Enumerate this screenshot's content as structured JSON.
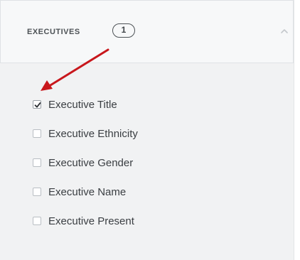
{
  "panel": {
    "title": "EXECUTIVES",
    "selected_count": "1",
    "toggle_icon": "chevron-up-icon"
  },
  "options": [
    {
      "label": "Executive Title",
      "checked": true
    },
    {
      "label": "Executive Ethnicity",
      "checked": false
    },
    {
      "label": "Executive Gender",
      "checked": false
    },
    {
      "label": "Executive Name",
      "checked": false
    },
    {
      "label": "Executive Present",
      "checked": false
    }
  ],
  "annotation": {
    "icon": "red-arrow-icon",
    "color": "#c8171c"
  }
}
